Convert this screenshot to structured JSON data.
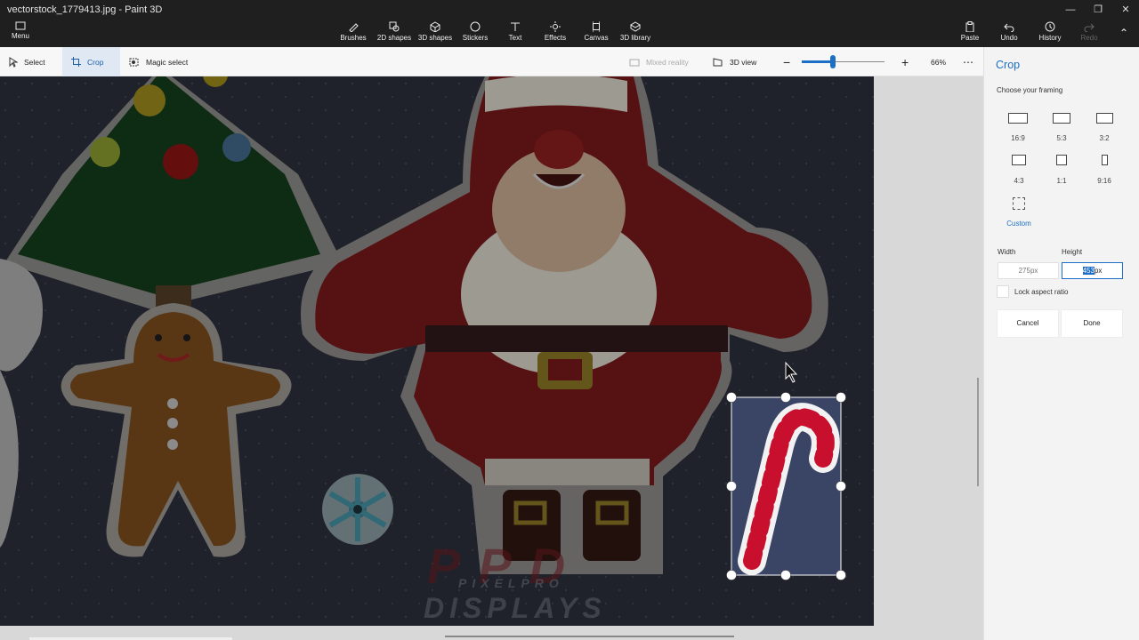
{
  "window": {
    "title": "vectorstock_1779413.jpg - Paint 3D"
  },
  "ribbon": {
    "menu": "Menu",
    "brushes": "Brushes",
    "shapes2d": "2D shapes",
    "shapes3d": "3D shapes",
    "stickers": "Stickers",
    "text": "Text",
    "effects": "Effects",
    "canvas": "Canvas",
    "library3d": "3D library",
    "paste": "Paste",
    "undo": "Undo",
    "history": "History",
    "redo": "Redo"
  },
  "toolbar": {
    "select": "Select",
    "crop": "Crop",
    "magic_select": "Magic select",
    "mixed_reality": "Mixed reality",
    "view3d": "3D view",
    "zoom_label": "66%",
    "zoom_level": 0.38
  },
  "panel": {
    "title": "Crop",
    "subtitle": "Choose your framing",
    "framings": [
      {
        "label": "16:9"
      },
      {
        "label": "5:3"
      },
      {
        "label": "3:2"
      },
      {
        "label": "4:3"
      },
      {
        "label": "1:1"
      },
      {
        "label": "9:16"
      },
      {
        "label": "Custom"
      }
    ],
    "width_label": "Width",
    "height_label": "Height",
    "width_value": "275px",
    "height_value_selected": "453",
    "height_value_unit": "px",
    "lock_label": "Lock aspect ratio",
    "cancel": "Cancel",
    "done": "Done"
  },
  "watermark": {
    "line1": "PPD",
    "line2": "PIXELPRO",
    "line3": "DISPLAYS"
  },
  "colors": {
    "accent": "#1c6fc4",
    "canvas_bg": "#2a2e38",
    "santa_red": "#7a1d1f"
  }
}
